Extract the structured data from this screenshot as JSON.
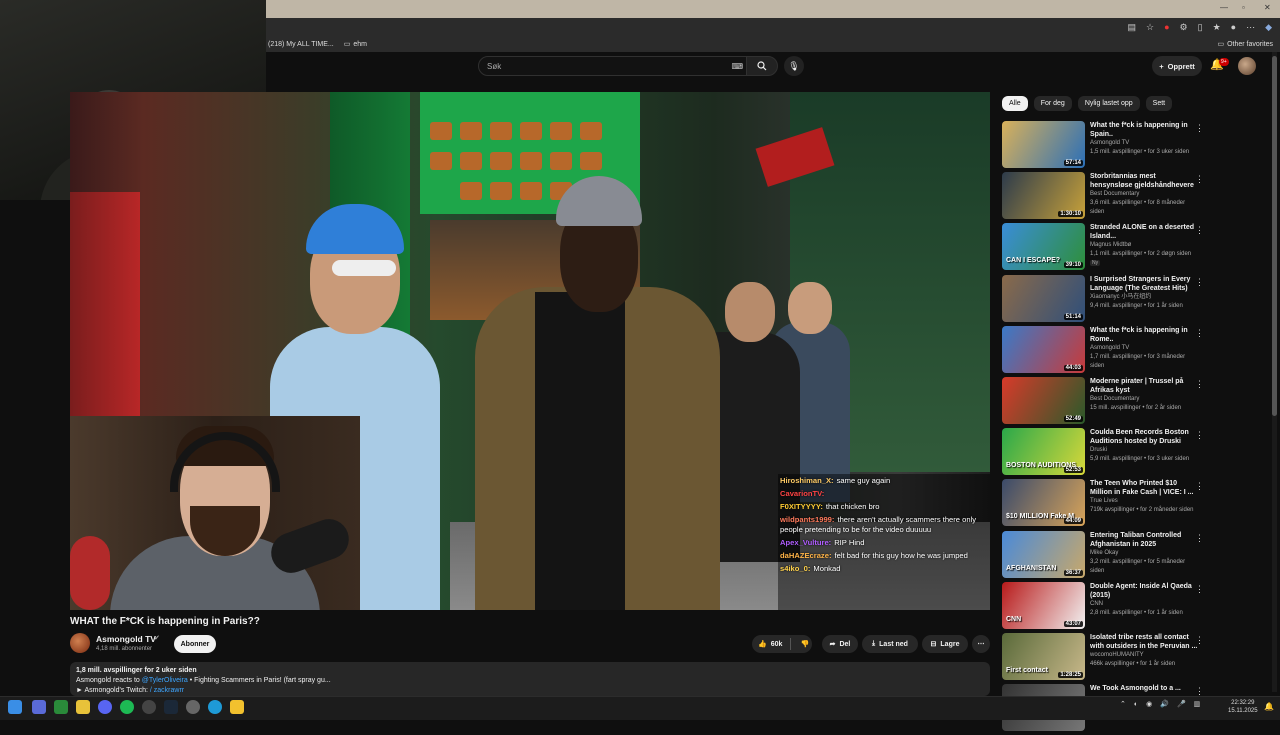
{
  "browser": {
    "bookmarks": [
      {
        "label": "(218) My ALL TIME..."
      },
      {
        "label": "ehm"
      }
    ],
    "other_favorites": "Other favorites"
  },
  "header": {
    "search_placeholder": "Søk",
    "create_label": "Opprett",
    "notification_count": "9+"
  },
  "video": {
    "title": "WHAT the F*CK is happening in Paris??",
    "channel": "Asmongold TV",
    "subscribers": "4,18 mill. abonnenter",
    "subscribe_label": "Abonner",
    "likes": "60k",
    "share_label": "Del",
    "download_label": "Last ned",
    "save_label": "Lagre",
    "description_meta": "1,8 mill. avspillinger  for 2 uker siden",
    "description_line2_prefix": "Asmongold reacts to ",
    "description_handle": "@TylerOliveira",
    "description_line2_suffix": " • Fighting Scammers in Paris! (fart spray gu...",
    "description_line3_prefix": "► Asmongold's Twitch: ",
    "description_line3_link": "/ zackrawrr"
  },
  "chat": [
    {
      "user": "Hiroshiman_X:",
      "color": "#ffcc66",
      "text": "same guy again"
    },
    {
      "user": "CavarionTV:",
      "color": "#ff4444",
      "text": ""
    },
    {
      "user": "F0XITYYYY:",
      "color": "#ffcc33",
      "text": "that chicken bro"
    },
    {
      "user": "wildpants1999:",
      "color": "#ff7a5c",
      "text": "there aren't actually scammers there only people pretending to be for the video duuuuu"
    },
    {
      "user": "Apex_Vulture:",
      "color": "#b05cff",
      "text": "RIP Hind"
    },
    {
      "user": "daHAZEcraze:",
      "color": "#ffb347",
      "text": "felt bad for this guy how he was jumped"
    },
    {
      "user": "s4iko_0:",
      "color": "#ffd24d",
      "text": "Monkad"
    }
  ],
  "chips": [
    "Alle",
    "For deg",
    "Nylig lastet opp",
    "Sett"
  ],
  "recommendations": [
    {
      "title": "What the f*ck is happening in Spain..",
      "channel": "Asmongold TV",
      "meta": "1,5 mill. avspillinger • for 3 uker siden",
      "duration": "57:14",
      "thumb": "linear-gradient(120deg,#d9b15a,#2b6fb7)",
      "thumb_text": "",
      "badge": ""
    },
    {
      "title": "Storbritannias mest hensynsløse gjeldshåndhevere",
      "channel": "Best Documentary",
      "meta": "3,6 mill. avspillinger • for 8 måneder siden",
      "duration": "1:30:10",
      "thumb": "linear-gradient(120deg,#2d3b4b,#c7a13a)",
      "thumb_text": "",
      "badge": ""
    },
    {
      "title": "Stranded ALONE on a deserted Island...",
      "channel": "Magnus Midtbø",
      "meta": "1,1 mill. avspillinger • for 2 døgn siden",
      "duration": "39:10",
      "thumb": "linear-gradient(120deg,#3a8dd8,#2e8f3a)",
      "thumb_text": "CAN I ESCAPE?",
      "badge": "Ny"
    },
    {
      "title": "I Surprised Strangers in Every Language (The Greatest Hits)",
      "channel": "Xiaomanyc 小马在纽约",
      "meta": "9,4 mill. avspillinger • for 1 år siden",
      "duration": "51:14",
      "thumb": "linear-gradient(120deg,#8a6a4a,#2f4f7a)",
      "thumb_text": "",
      "badge": ""
    },
    {
      "title": "What the f*ck is happening in Rome..",
      "channel": "Asmongold TV",
      "meta": "1,7 mill. avspillinger • for 3 måneder siden",
      "duration": "44:03",
      "thumb": "linear-gradient(120deg,#3a7ac8,#c83a3a)",
      "thumb_text": "",
      "badge": ""
    },
    {
      "title": "Moderne pirater | Trussel på Afrikas kyst",
      "channel": "Best Documentary",
      "meta": "15 mill. avspillinger • for 2 år siden",
      "duration": "52:49",
      "thumb": "linear-gradient(120deg,#d83a2a,#2a5a2a)",
      "thumb_text": "",
      "badge": ""
    },
    {
      "title": "Coulda Been Records Boston Auditions hosted by Druski",
      "channel": "Druski",
      "meta": "5,9 mill. avspillinger • for 3 uker siden",
      "duration": "52:53",
      "thumb": "linear-gradient(120deg,#2aa84a,#d8d83a)",
      "thumb_text": "BOSTON AUDITIONS",
      "badge": ""
    },
    {
      "title": "The Teen Who Printed $10 Million in Fake Cash | VICE: I ...",
      "channel": "True Lives",
      "meta": "719k avspillinger • for 2 måneder siden",
      "duration": "44:09",
      "thumb": "linear-gradient(120deg,#3a4a6a,#d8a45a)",
      "thumb_text": "$10 MILLION Fake M",
      "badge": ""
    },
    {
      "title": "Entering Taliban Controlled Afghanistan in 2025",
      "channel": "Mike Okay",
      "meta": "3,2 mill. avspillinger • for 5 måneder siden",
      "duration": "36:37",
      "thumb": "linear-gradient(120deg,#4a8ad8,#c8a86a)",
      "thumb_text": "AFGHANISTAN",
      "badge": ""
    },
    {
      "title": "Double Agent: Inside Al Qaeda (2015)",
      "channel": "CNN",
      "meta": "2,8 mill. avspillinger • for 1 år siden",
      "duration": "43:07",
      "thumb": "linear-gradient(120deg,#b81a1a,#f2f2f2)",
      "thumb_text": "CNN",
      "badge": ""
    },
    {
      "title": "Isolated tribe rests all contact with outsiders in the Peruvian ...",
      "channel": "wocomoHUMANITY",
      "meta": "466k avspillinger • for 1 år siden",
      "duration": "1:28:25",
      "thumb": "linear-gradient(120deg,#5a6a3a,#c8b88a)",
      "thumb_text": "First contact",
      "badge": ""
    },
    {
      "title": "We Took Asmongold to a ...",
      "channel": "",
      "meta": "",
      "duration": "",
      "thumb": "linear-gradient(120deg,#333,#777)",
      "thumb_text": "",
      "badge": ""
    }
  ],
  "taskbar": {
    "time": "22:32:29",
    "date": "15.11.2025"
  }
}
